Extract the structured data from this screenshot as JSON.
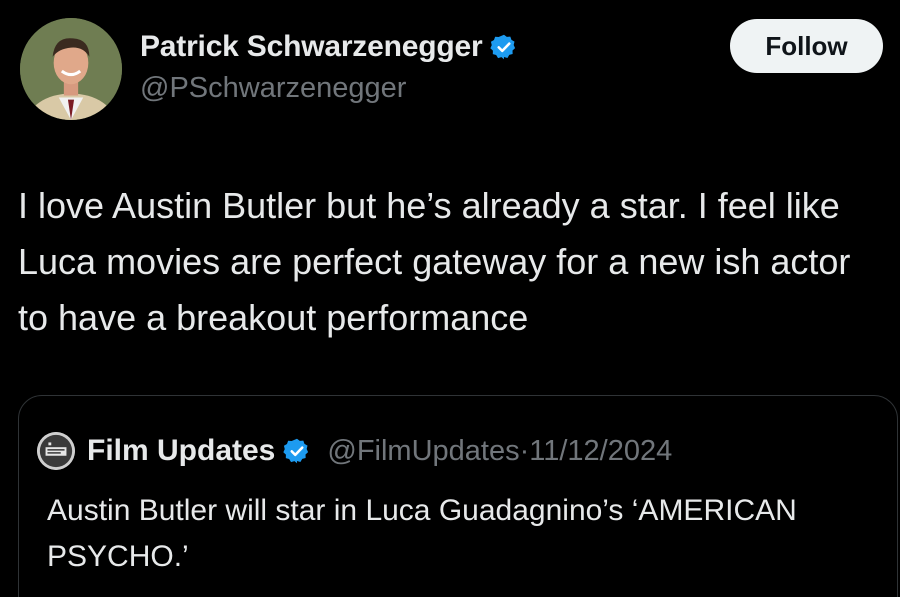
{
  "tweet": {
    "author": {
      "display_name": "Patrick Schwarzenegger",
      "handle": "@PSchwarzenegger",
      "verified": true
    },
    "follow_label": "Follow",
    "text": "I love Austin Butler but he’s already a star. I feel like Luca movies are perfect gateway for a new ish actor to have a breakout performance"
  },
  "quote": {
    "author": {
      "display_name": "Film Updates",
      "handle": "@FilmUpdates",
      "verified": true
    },
    "separator": "·",
    "date": "11/12/2024",
    "text": "Austin Butler will star in Luca Guadagnino’s ‘AMERICAN PSYCHO.’"
  },
  "colors": {
    "background": "#000000",
    "text_primary": "#e7e9ea",
    "text_secondary": "#71767b",
    "verified_blue": "#1d9bf0",
    "follow_button_bg": "#eff3f4",
    "border": "#2f3336"
  },
  "icons": {
    "verified": "verified-badge-icon"
  }
}
